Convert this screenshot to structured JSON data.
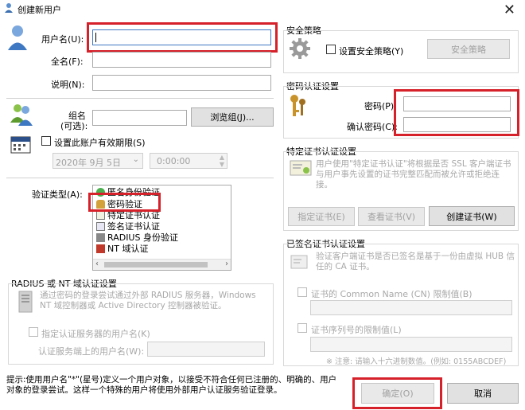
{
  "window": {
    "title": "创建新用户",
    "close_glyph": "✕"
  },
  "user": {
    "username_label": "用户名(U):",
    "fullname_label": "全名(F):",
    "description_label": "说明(N):",
    "group_label_line1": "组名",
    "group_label_line2": "(可选):",
    "browse_group_button": "浏览组(J)...",
    "expiry_checkbox_label": "设置此账户有效期限(S)",
    "expiry_date": "2020年 9月 5日",
    "expiry_time": "0:00:00"
  },
  "auth": {
    "auth_type_label": "验证类型(A):",
    "items": [
      {
        "label": "匿名身份验证",
        "icon": "anonymous-icon"
      },
      {
        "label": "密码验证",
        "icon": "key-icon"
      },
      {
        "label": "特定证书认证",
        "icon": "certificate-icon"
      },
      {
        "label": "签名证书认证",
        "icon": "signed-certificate-icon"
      },
      {
        "label": "RADIUS 身份验证",
        "icon": "radius-icon"
      },
      {
        "label": "NT 域认证",
        "icon": "nt-domain-icon"
      }
    ]
  },
  "radius": {
    "section_title": "RADIUS 或 NT 域认证设置",
    "description": "通过密码的登录尝试通过外部 RADIUS 服务器，Windows NT 域控制器或 Active Directory 控制器被验证。",
    "specify_user_checkbox": "指定认证服务器的用户名(K)",
    "server_username_label": "认证服务端上的用户名(W):"
  },
  "security": {
    "section_title": "安全策略",
    "checkbox_label": "设置安全策略(Y)",
    "button": "安全策略"
  },
  "password": {
    "section_title": "密码认证设置",
    "password_label": "密码(P):",
    "confirm_label": "确认密码(C):"
  },
  "cert": {
    "section_title": "特定证书认证设置",
    "description": "用户使用\"特定证书认证\"将根据是否 SSL 客户端证书与用户事先设置的证书完整匹配而被允许或拒绝连接。",
    "specify_button": "指定证书(E)",
    "view_button": "查看证书(V)",
    "create_button": "创建证书(W)"
  },
  "signed": {
    "section_title": "已签名证书认证设置",
    "description": "验证客户端证书是否已签名是基于一份由虚拟 HUB 信任的 CA 证书。",
    "cn_checkbox": "证书的 Common Name (CN) 限制值(B)",
    "serial_checkbox": "证书序列号的限制值(L)",
    "note": "※ 注意: 请输入十六进制数值。(例如: 0155ABCDEF)"
  },
  "footer": {
    "hint": "提示:使用用户名\"*\"(星号)定义一个用户对象，以接受不符合任何已注册的、明确的、用户对象的登录尝试。这样一个特殊的用户将使用外部用户认证服务验证登录。",
    "ok_button": "确定(O)",
    "cancel_button": "取消"
  },
  "colors": {
    "highlight": "#d6202a",
    "disabled_text": "#a8a8a8",
    "button_face": "#e1e1e1"
  }
}
